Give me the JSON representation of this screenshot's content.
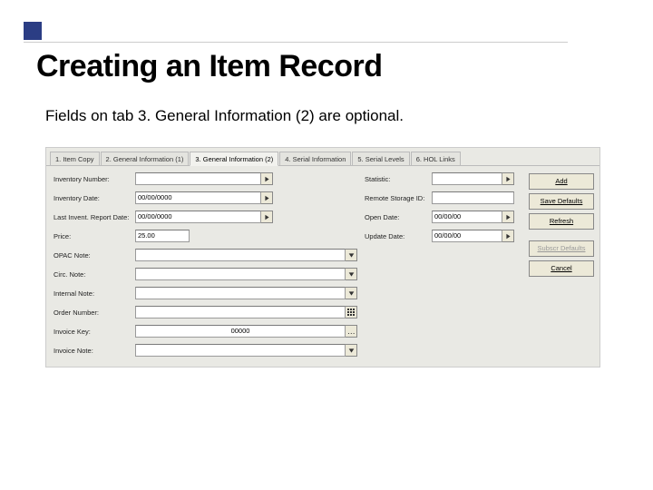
{
  "slide": {
    "title": "Creating an Item Record",
    "subtitle": "Fields on tab 3. General Information (2) are optional."
  },
  "tabs": [
    {
      "label": "1. Item Copy"
    },
    {
      "label": "2. General Information (1)"
    },
    {
      "label": "3. General Information (2)"
    },
    {
      "label": "4. Serial Information"
    },
    {
      "label": "5. Serial Levels"
    },
    {
      "label": "6. HOL Links"
    }
  ],
  "leftFields": {
    "inventoryNumber": {
      "label": "Inventory Number:",
      "value": ""
    },
    "inventoryDate": {
      "label": "Inventory Date:",
      "value": "00/00/0000"
    },
    "lastReport": {
      "label": "Last Invent. Report Date:",
      "value": "00/00/0000"
    },
    "price": {
      "label": "Price:",
      "value": "25.00"
    },
    "opacNote": {
      "label": "OPAC Note:",
      "value": ""
    },
    "circNote": {
      "label": "Circ. Note:",
      "value": ""
    },
    "internalNote": {
      "label": "Internal Note:",
      "value": ""
    },
    "orderNumber": {
      "label": "Order Number:",
      "value": ""
    },
    "invoiceKey": {
      "label": "Invoice Key:",
      "value": "00000"
    },
    "invoiceNote": {
      "label": "Invoice Note:",
      "value": ""
    }
  },
  "rightFields": {
    "statistic": {
      "label": "Statistic:",
      "value": ""
    },
    "remoteStorage": {
      "label": "Remote Storage ID:",
      "value": ""
    },
    "openDate": {
      "label": "Open Date:",
      "value": "00/00/00"
    },
    "updateDate": {
      "label": "Update Date:",
      "value": "00/00/00"
    }
  },
  "sidebar": {
    "add": "Add",
    "saveDefaults": "Save Defaults",
    "refresh": "Refresh",
    "subscrDefaults": "Subscr Defaults",
    "cancel": "Cancel"
  }
}
